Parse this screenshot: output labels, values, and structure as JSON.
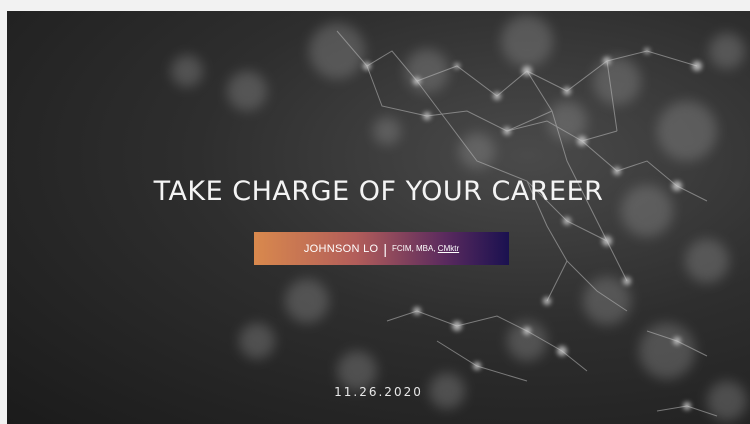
{
  "slide": {
    "title": "TAKE CHARGE OF YOUR CAREER",
    "presenter": {
      "name": "JOHNSON LO",
      "separator": "|",
      "credentials_prefix": "FCIM, MBA, ",
      "credentials_link": "CMktr"
    },
    "date": "11.26.2020"
  },
  "colors": {
    "background": "#2a2a2a",
    "banner_start": "#d9894d",
    "banner_end": "#1a1150",
    "text": "#f4f4f4"
  },
  "background_image": "network-bokeh-graphic"
}
